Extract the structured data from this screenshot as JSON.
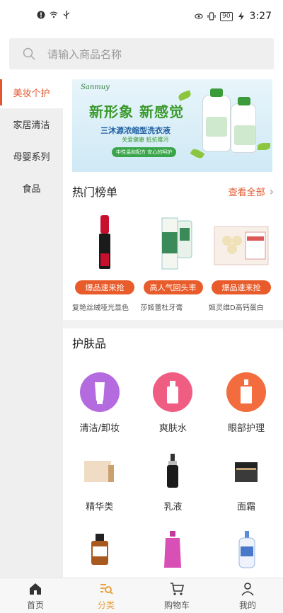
{
  "status_bar": {
    "time": "3:27",
    "battery": "90"
  },
  "search": {
    "placeholder": "请输入商品名称"
  },
  "sidebar": {
    "items": [
      {
        "label": "美妆个护",
        "active": true
      },
      {
        "label": "家居清洁",
        "active": false
      },
      {
        "label": "母婴系列",
        "active": false
      },
      {
        "label": "食品",
        "active": false
      }
    ]
  },
  "banner": {
    "logo": "Sanmuy",
    "headline": "新形象  新感觉",
    "subtitle": "三沐源浓缩型洗衣液",
    "tagline": "关爱健康  抵抗霉污",
    "pill": "中性温和配方  安心的呵护"
  },
  "hot": {
    "title": "热门榜单",
    "more": "查看全部",
    "items": [
      {
        "badge": "爆品速来抢",
        "name": "复艳丝绒哑光显色"
      },
      {
        "badge": "高人气回头率",
        "name": "莎姬蕾杜牙膏"
      },
      {
        "badge": "爆品速来抢",
        "name": "姬灵维D高钙蛋白"
      }
    ]
  },
  "skincare": {
    "title": "护肤品",
    "items": [
      {
        "label": "清洁/卸妆"
      },
      {
        "label": "爽肤水"
      },
      {
        "label": "眼部护理"
      },
      {
        "label": "精华类"
      },
      {
        "label": "乳液"
      },
      {
        "label": "面霜"
      }
    ]
  },
  "bottom_nav": {
    "items": [
      {
        "label": "首页",
        "icon": "home-icon",
        "active": false
      },
      {
        "label": "分类",
        "icon": "category-search-icon",
        "active": true
      },
      {
        "label": "购物车",
        "icon": "cart-icon",
        "active": false
      },
      {
        "label": "我的",
        "icon": "user-icon",
        "active": false
      }
    ]
  },
  "colors": {
    "accent": "#e4572e",
    "nav_active": "#e6a23c",
    "badge": "#e85b2a"
  }
}
